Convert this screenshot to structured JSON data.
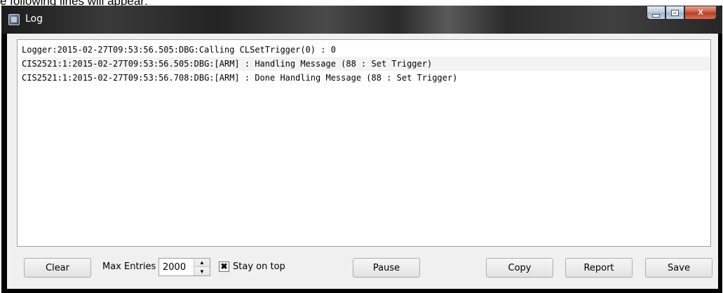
{
  "page_caption": "e following lines will appear:",
  "window": {
    "title": "Log",
    "controls": {
      "minimize": "_",
      "maximize": "□",
      "close": "X"
    }
  },
  "log": {
    "lines": [
      "Logger:2015-02-27T09:53:56.505:DBG:Calling CLSetTrigger(0) : 0",
      "CIS2521:1:2015-02-27T09:53:56.505:DBG:[ARM] : Handling Message (88 : Set Trigger)",
      "CIS2521:1:2015-02-27T09:53:56.708:DBG:[ARM] : Done Handling Message (88 : Set Trigger)"
    ]
  },
  "toolbar": {
    "clear_label": "Clear",
    "max_entries_label": "Max Entries",
    "max_entries_value": "2000",
    "stay_on_top_label": "Stay on top",
    "stay_on_top_checked": true,
    "pause_label": "Pause",
    "copy_label": "Copy",
    "report_label": "Report",
    "save_label": "Save"
  },
  "icons": {
    "app": "app-window-icon",
    "spin_up": "▲",
    "spin_down": "▼",
    "check": "✖"
  }
}
